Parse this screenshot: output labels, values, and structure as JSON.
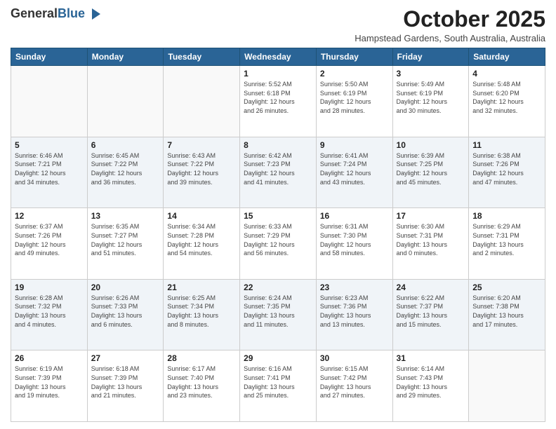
{
  "header": {
    "logo_general": "General",
    "logo_blue": "Blue",
    "month_title": "October 2025",
    "location": "Hampstead Gardens, South Australia, Australia"
  },
  "days_of_week": [
    "Sunday",
    "Monday",
    "Tuesday",
    "Wednesday",
    "Thursday",
    "Friday",
    "Saturday"
  ],
  "weeks": [
    [
      {
        "day": "",
        "info": ""
      },
      {
        "day": "",
        "info": ""
      },
      {
        "day": "",
        "info": ""
      },
      {
        "day": "1",
        "info": "Sunrise: 5:52 AM\nSunset: 6:18 PM\nDaylight: 12 hours\nand 26 minutes."
      },
      {
        "day": "2",
        "info": "Sunrise: 5:50 AM\nSunset: 6:19 PM\nDaylight: 12 hours\nand 28 minutes."
      },
      {
        "day": "3",
        "info": "Sunrise: 5:49 AM\nSunset: 6:19 PM\nDaylight: 12 hours\nand 30 minutes."
      },
      {
        "day": "4",
        "info": "Sunrise: 5:48 AM\nSunset: 6:20 PM\nDaylight: 12 hours\nand 32 minutes."
      }
    ],
    [
      {
        "day": "5",
        "info": "Sunrise: 6:46 AM\nSunset: 7:21 PM\nDaylight: 12 hours\nand 34 minutes."
      },
      {
        "day": "6",
        "info": "Sunrise: 6:45 AM\nSunset: 7:22 PM\nDaylight: 12 hours\nand 36 minutes."
      },
      {
        "day": "7",
        "info": "Sunrise: 6:43 AM\nSunset: 7:22 PM\nDaylight: 12 hours\nand 39 minutes."
      },
      {
        "day": "8",
        "info": "Sunrise: 6:42 AM\nSunset: 7:23 PM\nDaylight: 12 hours\nand 41 minutes."
      },
      {
        "day": "9",
        "info": "Sunrise: 6:41 AM\nSunset: 7:24 PM\nDaylight: 12 hours\nand 43 minutes."
      },
      {
        "day": "10",
        "info": "Sunrise: 6:39 AM\nSunset: 7:25 PM\nDaylight: 12 hours\nand 45 minutes."
      },
      {
        "day": "11",
        "info": "Sunrise: 6:38 AM\nSunset: 7:26 PM\nDaylight: 12 hours\nand 47 minutes."
      }
    ],
    [
      {
        "day": "12",
        "info": "Sunrise: 6:37 AM\nSunset: 7:26 PM\nDaylight: 12 hours\nand 49 minutes."
      },
      {
        "day": "13",
        "info": "Sunrise: 6:35 AM\nSunset: 7:27 PM\nDaylight: 12 hours\nand 51 minutes."
      },
      {
        "day": "14",
        "info": "Sunrise: 6:34 AM\nSunset: 7:28 PM\nDaylight: 12 hours\nand 54 minutes."
      },
      {
        "day": "15",
        "info": "Sunrise: 6:33 AM\nSunset: 7:29 PM\nDaylight: 12 hours\nand 56 minutes."
      },
      {
        "day": "16",
        "info": "Sunrise: 6:31 AM\nSunset: 7:30 PM\nDaylight: 12 hours\nand 58 minutes."
      },
      {
        "day": "17",
        "info": "Sunrise: 6:30 AM\nSunset: 7:31 PM\nDaylight: 13 hours\nand 0 minutes."
      },
      {
        "day": "18",
        "info": "Sunrise: 6:29 AM\nSunset: 7:31 PM\nDaylight: 13 hours\nand 2 minutes."
      }
    ],
    [
      {
        "day": "19",
        "info": "Sunrise: 6:28 AM\nSunset: 7:32 PM\nDaylight: 13 hours\nand 4 minutes."
      },
      {
        "day": "20",
        "info": "Sunrise: 6:26 AM\nSunset: 7:33 PM\nDaylight: 13 hours\nand 6 minutes."
      },
      {
        "day": "21",
        "info": "Sunrise: 6:25 AM\nSunset: 7:34 PM\nDaylight: 13 hours\nand 8 minutes."
      },
      {
        "day": "22",
        "info": "Sunrise: 6:24 AM\nSunset: 7:35 PM\nDaylight: 13 hours\nand 11 minutes."
      },
      {
        "day": "23",
        "info": "Sunrise: 6:23 AM\nSunset: 7:36 PM\nDaylight: 13 hours\nand 13 minutes."
      },
      {
        "day": "24",
        "info": "Sunrise: 6:22 AM\nSunset: 7:37 PM\nDaylight: 13 hours\nand 15 minutes."
      },
      {
        "day": "25",
        "info": "Sunrise: 6:20 AM\nSunset: 7:38 PM\nDaylight: 13 hours\nand 17 minutes."
      }
    ],
    [
      {
        "day": "26",
        "info": "Sunrise: 6:19 AM\nSunset: 7:39 PM\nDaylight: 13 hours\nand 19 minutes."
      },
      {
        "day": "27",
        "info": "Sunrise: 6:18 AM\nSunset: 7:39 PM\nDaylight: 13 hours\nand 21 minutes."
      },
      {
        "day": "28",
        "info": "Sunrise: 6:17 AM\nSunset: 7:40 PM\nDaylight: 13 hours\nand 23 minutes."
      },
      {
        "day": "29",
        "info": "Sunrise: 6:16 AM\nSunset: 7:41 PM\nDaylight: 13 hours\nand 25 minutes."
      },
      {
        "day": "30",
        "info": "Sunrise: 6:15 AM\nSunset: 7:42 PM\nDaylight: 13 hours\nand 27 minutes."
      },
      {
        "day": "31",
        "info": "Sunrise: 6:14 AM\nSunset: 7:43 PM\nDaylight: 13 hours\nand 29 minutes."
      },
      {
        "day": "",
        "info": ""
      }
    ]
  ]
}
